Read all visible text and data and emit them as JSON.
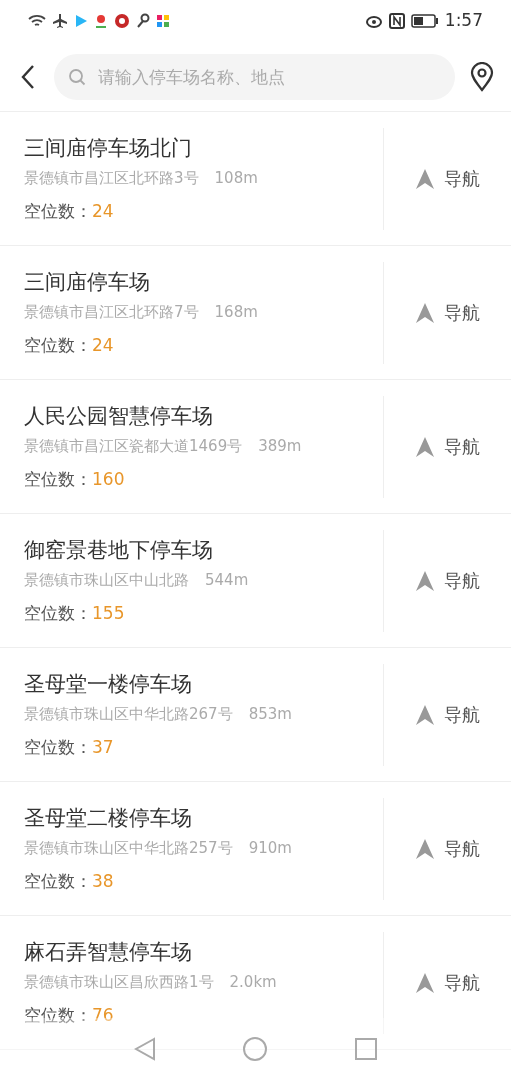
{
  "status_bar": {
    "time": "1:57"
  },
  "search": {
    "placeholder": "请输入停车场名称、地点"
  },
  "parkings": [
    {
      "name": "三间庙停车场北门",
      "address": "景德镇市昌江区北环路3号",
      "distance": "108m",
      "spaces_label": "空位数：",
      "spaces": "24",
      "nav": "导航"
    },
    {
      "name": "三间庙停车场",
      "address": "景德镇市昌江区北环路7号",
      "distance": "168m",
      "spaces_label": "空位数：",
      "spaces": "24",
      "nav": "导航"
    },
    {
      "name": "人民公园智慧停车场",
      "address": "景德镇市昌江区瓷都大道1469号",
      "distance": "389m",
      "spaces_label": "空位数：",
      "spaces": "160",
      "nav": "导航"
    },
    {
      "name": "御窑景巷地下停车场",
      "address": "景德镇市珠山区中山北路",
      "distance": "544m",
      "spaces_label": "空位数：",
      "spaces": "155",
      "nav": "导航"
    },
    {
      "name": "圣母堂一楼停车场",
      "address": "景德镇市珠山区中华北路267号",
      "distance": "853m",
      "spaces_label": "空位数：",
      "spaces": "37",
      "nav": "导航"
    },
    {
      "name": "圣母堂二楼停车场",
      "address": "景德镇市珠山区中华北路257号",
      "distance": "910m",
      "spaces_label": "空位数：",
      "spaces": "38",
      "nav": "导航"
    },
    {
      "name": "麻石弄智慧停车场",
      "address": "景德镇市珠山区昌欣西路1号",
      "distance": "2.0km",
      "spaces_label": "空位数：",
      "spaces": "76",
      "nav": "导航"
    }
  ]
}
